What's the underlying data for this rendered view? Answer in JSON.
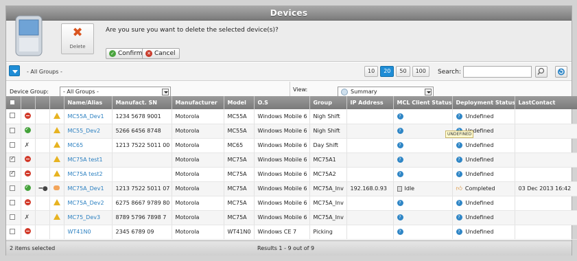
{
  "window": {
    "title": "Devices"
  },
  "confirm": {
    "delete_label": "Delete",
    "question": "Are you sure you want to delete the selected device(s)?",
    "confirm_label": "Confirm",
    "cancel_label": "Cancel"
  },
  "toolbar": {
    "group_label": "- All Groups -",
    "page_sizes": [
      "10",
      "20",
      "50",
      "100"
    ],
    "active_page_size": "20",
    "search_label": "Search:",
    "search_value": ""
  },
  "filters": {
    "device_group_label": "Device Group:",
    "device_group_value": "- All Groups -",
    "view_label": "View:",
    "view_value": "Summary"
  },
  "columns": [
    "",
    "",
    "",
    "",
    "Name/Alias",
    "Manufact. SN",
    "Manufacturer",
    "Model",
    "O.S",
    "Group",
    "IP Address",
    "MCL Client Status",
    "Deployment Status",
    "LastContact"
  ],
  "rows": [
    {
      "checked": false,
      "status": "red",
      "tools": false,
      "plug": false,
      "warn": "warn",
      "name": "MC55A_Dev1",
      "sn": "1234 5678 9001",
      "mfr": "Motorola",
      "model": "MC55A",
      "os": "Windows Mobile 6",
      "group": "Nigh Shift",
      "ip": "",
      "mcl": "",
      "mcl_icon": "question",
      "deploy": "Undefined",
      "deploy_icon": "question",
      "last": ""
    },
    {
      "checked": false,
      "status": "green",
      "tools": false,
      "plug": false,
      "warn": "warn",
      "name": "MC55_Dev2",
      "sn": "5266 6456 8748",
      "mfr": "Motorola",
      "model": "MC55A",
      "os": "Windows Mobile 6",
      "group": "Nigh Shift",
      "ip": "",
      "mcl": "",
      "mcl_icon": "question",
      "deploy": "Undefined",
      "deploy_icon": "question",
      "last": ""
    },
    {
      "checked": false,
      "status": "tools",
      "tools": true,
      "plug": false,
      "warn": "warn",
      "name": "MC65",
      "sn": "1213 7522 5011 00",
      "mfr": "Motorola",
      "model": "MC65",
      "os": "Windows Mobile 6",
      "group": "Day Shift",
      "ip": "",
      "mcl": "",
      "mcl_icon": "question",
      "deploy": "Undefined",
      "deploy_icon": "question",
      "last": ""
    },
    {
      "checked": true,
      "status": "red",
      "tools": false,
      "plug": false,
      "warn": "warn",
      "name": "MC75A test1",
      "sn": "",
      "mfr": "Motorola",
      "model": "MC75A",
      "os": "Windows Mobile 6",
      "group": "MC75A1",
      "ip": "",
      "mcl": "",
      "mcl_icon": "question",
      "deploy": "Undefined",
      "deploy_icon": "question",
      "last": ""
    },
    {
      "checked": true,
      "status": "red",
      "tools": false,
      "plug": false,
      "warn": "warn",
      "name": "MC75A test2",
      "sn": "",
      "mfr": "Motorola",
      "model": "MC75A",
      "os": "Windows Mobile 6",
      "group": "MC75A2",
      "ip": "",
      "mcl": "",
      "mcl_icon": "question",
      "deploy": "Undefined",
      "deploy_icon": "question",
      "last": ""
    },
    {
      "checked": false,
      "status": "green",
      "tools": false,
      "plug": true,
      "warn": "bubble",
      "name": "MC75A_Dev1",
      "sn": "1213 7522 5011 07",
      "mfr": "Motorola",
      "model": "MC75A",
      "os": "Windows Mobile 6",
      "group": "MC75A_Inv",
      "ip": "192.168.0.93",
      "mcl": "Idle",
      "mcl_icon": "idle",
      "deploy": "Completed",
      "deploy_icon": "thumb",
      "last": "03 Dec 2013 16:42"
    },
    {
      "checked": false,
      "status": "red",
      "tools": false,
      "plug": false,
      "warn": "warn",
      "name": "MC75A_Dev2",
      "sn": "6275 8667 9789 80",
      "mfr": "Motorola",
      "model": "MC75A",
      "os": "Windows Mobile 6",
      "group": "MC75A_Inv",
      "ip": "",
      "mcl": "",
      "mcl_icon": "question",
      "deploy": "Undefined",
      "deploy_icon": "question",
      "last": ""
    },
    {
      "checked": false,
      "status": "tools",
      "tools": true,
      "plug": false,
      "warn": "warn",
      "name": "MC75_Dev3",
      "sn": "8789 5796 7898 7",
      "mfr": "Motorola",
      "model": "MC75A",
      "os": "Windows Mobile 6",
      "group": "MC75A_Inv",
      "ip": "",
      "mcl": "",
      "mcl_icon": "question",
      "deploy": "Undefined",
      "deploy_icon": "question",
      "last": ""
    },
    {
      "checked": false,
      "status": "red",
      "tools": false,
      "plug": false,
      "warn": "none",
      "name": "WT41N0",
      "sn": "2345 6789 09",
      "mfr": "Motorola",
      "model": "WT41N0",
      "os": "Windows CE 7",
      "group": "Picking",
      "ip": "",
      "mcl": "",
      "mcl_icon": "question",
      "deploy": "Undefined",
      "deploy_icon": "question",
      "last": ""
    }
  ],
  "tooltip": "UNDEFINED",
  "footer": {
    "selected": "2 items selected",
    "results": "Results 1 - 9 out of 9"
  }
}
